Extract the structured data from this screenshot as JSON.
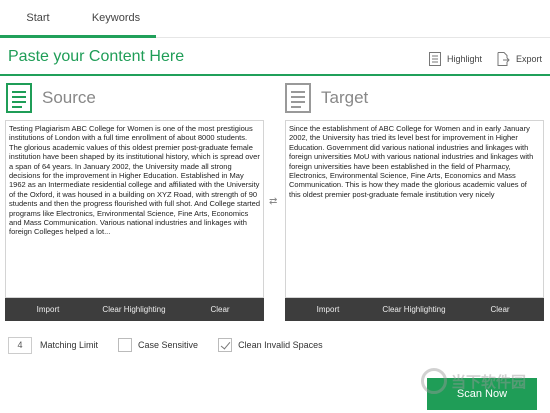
{
  "tabs": [
    {
      "label": "Start"
    },
    {
      "label": "Keywords"
    }
  ],
  "header": {
    "title": "Paste your Content Here",
    "highlight_label": "Highlight",
    "export_label": "Export"
  },
  "source": {
    "title": "Source",
    "text": "Testing Plagiarism ABC College for Women is one of the most prestigious institutions of London with a full time enrollment of about 8000 students. The glorious academic values of this oldest premier post-graduate female institution have been shaped by its institutional history, which is spread over a span of 64 years. In January 2002, the University made all strong decisions for the improvement in Higher Education. Established in May 1962 as an Intermediate residential college and affiliated with the University of the Oxford, it was housed in a building on XYZ Road, with strength of 90 students and then the progress flourished with full shot. And College started programs like Electronics, Environmental Science, Fine Arts, Economics and Mass Communication. Various national industries and linkages with foreign Colleges helped a lot...",
    "import_label": "Import",
    "clear_highlighting_label": "Clear Highlighting",
    "clear_label": "Clear"
  },
  "target": {
    "title": "Target",
    "text": "Since the establishment of ABC College for Women and in early January 2002, the University has tried its level best for improvement in Higher Education. Government did various national industries and linkages with foreign universities MoU with various national industries and linkages with foreign universities have been established in the field of Pharmacy, Electronics, Environmental Science, Fine Arts, Economics and Mass Communication. This is how they made the glorious academic values of this oldest premier post-graduate female institution very nicely",
    "import_label": "Import",
    "clear_highlighting_label": "Clear Highlighting",
    "clear_label": "Clear"
  },
  "options": {
    "matching_limit_value": "4",
    "matching_limit_label": "Matching Limit",
    "case_sensitive_label": "Case Sensitive",
    "case_sensitive_checked": false,
    "clean_invalid_spaces_label": "Clean Invalid Spaces",
    "clean_invalid_spaces_checked": true
  },
  "scan_label": "Scan Now",
  "watermark_text": "当下软件园",
  "colors": {
    "accent": "#1f9d57",
    "toolbar": "#3d3d3d"
  },
  "icons": {
    "highlight": "document-lines-icon",
    "export": "export-document-icon",
    "source": "source-document-icon",
    "target": "target-document-icon",
    "swap": "swap-arrows-icon"
  }
}
